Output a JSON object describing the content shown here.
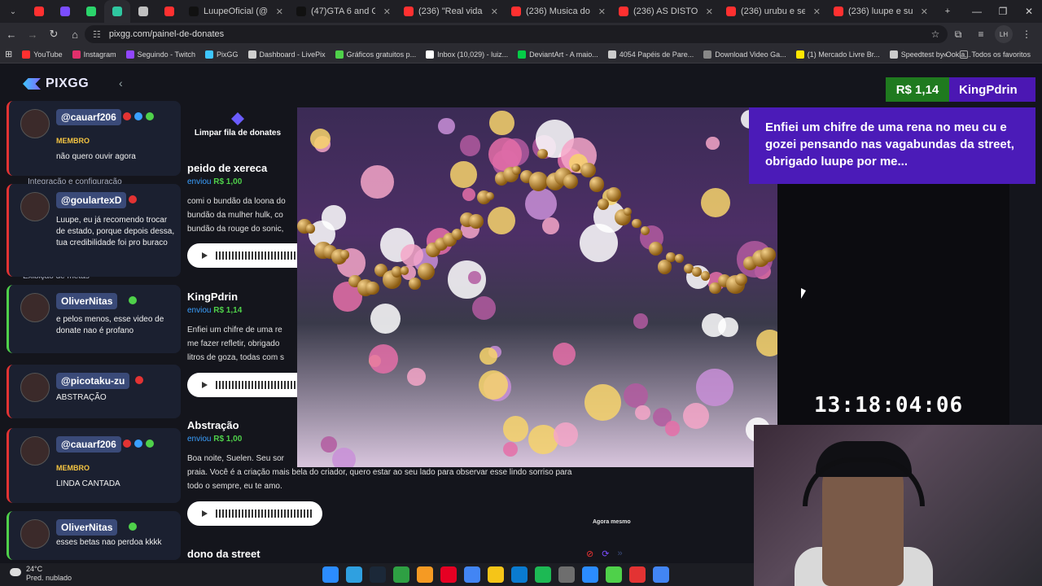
{
  "browser": {
    "tabs": [
      {
        "label": "",
        "color": "#ff3030",
        "mini": true
      },
      {
        "label": "",
        "color": "#7b4dff",
        "mini": true
      },
      {
        "label": "",
        "color": "#2bd46b",
        "mini": true
      },
      {
        "label": "",
        "color": "#2fc7a0",
        "mini": true,
        "active": true
      },
      {
        "label": "",
        "color": "#c0c0c0",
        "mini": true
      },
      {
        "label": "",
        "color": "#ff3030",
        "mini": true
      },
      {
        "label": "LuupeOficial (@luupe0f",
        "color": "#111111"
      },
      {
        "label": "(47)GTA 6 and God of W",
        "color": "#111111"
      },
      {
        "label": "(236) \"Real vida do Spid",
        "color": "#ff3030"
      },
      {
        "label": "(236) Musica do Rei da",
        "color": "#ff3030"
      },
      {
        "label": "(236) AS DISTORÇÕES",
        "color": "#ff3030"
      },
      {
        "label": "(236) urubu e seu segre",
        "color": "#ff3030"
      },
      {
        "label": "(236) luupe e sua festa",
        "color": "#ff3030"
      }
    ],
    "url": "pixgg.com/painel-de-donates",
    "bookmarks": [
      {
        "label": "YouTube",
        "color": "#ff3030"
      },
      {
        "label": "Instagram",
        "color": "#e1306c"
      },
      {
        "label": "Seguindo - Twitch",
        "color": "#9146ff"
      },
      {
        "label": "PixGG",
        "color": "#3ec6ff"
      },
      {
        "label": "Dashboard - LivePix",
        "color": "#cfcfcf"
      },
      {
        "label": "Gráficos gratuitos p...",
        "color": "#4fd14a"
      },
      {
        "label": "Inbox (10,029) - luiz...",
        "color": "#ffffff"
      },
      {
        "label": "DeviantArt - A maio...",
        "color": "#05cc47"
      },
      {
        "label": "4054 Papéis de Pare...",
        "color": "#cccccc"
      },
      {
        "label": "Download Video Ga...",
        "color": "#888888"
      },
      {
        "label": "(1) Mercado Livre Br...",
        "color": "#ffe600"
      },
      {
        "label": "Speedtest by Ookla...",
        "color": "#cccccc"
      }
    ],
    "bookmarks_all": "Todos os favoritos"
  },
  "app": {
    "logo": "PIXGG",
    "queue_clear_label": "Limpar fila de donates",
    "sidebar_labels": [
      "Integração e configuração",
      "Exibição de metas"
    ],
    "chat": [
      {
        "name": "@cauarf206",
        "membro": "MEMBRO",
        "text": "não quero ouvir agora",
        "border": "#e33333"
      },
      {
        "name": "@goulartexD",
        "membro": "",
        "text": "Luupe, eu já recomendo trocar de estado, porque depois dessa, tua credibilidade foi pro buraco",
        "border": "#e33333"
      },
      {
        "name": "OliverNitas",
        "membro": "",
        "text": "e pelos menos, esse video de donate nao é profano",
        "border": "#4fd14a"
      },
      {
        "name": "@picotaku-zu",
        "membro": "",
        "text": "ABSTRAÇÃO",
        "border": "#e33333"
      },
      {
        "name": "@cauarf206",
        "membro": "MEMBRO",
        "text": "LINDA CANTADA",
        "border": "#e33333"
      },
      {
        "name": "OliverNitas",
        "membro": "",
        "text": "esses betas nao perdoa kkkk",
        "border": "#4fd14a"
      }
    ],
    "donations": [
      {
        "name": "peido de xereca",
        "sent": "enviou",
        "amount": "R$ 1,00",
        "message": "comi o bundão da loona do",
        "message2": "bundão da mulher hulk, co",
        "message3": "bundão da rouge do sonic,"
      },
      {
        "name": "KingPdrin",
        "sent": "enviou",
        "amount": "R$ 1,14",
        "message": "Enfiei um chifre de uma re",
        "message2": "me fazer refletir, obrigado",
        "message3": "litros de goza, todas com s"
      },
      {
        "name": "Abstração",
        "sent": "enviou",
        "amount": "R$ 1,00",
        "message": "Boa noite, Suelen. Seu sor",
        "message2": "praia. Você é a criação mais bela do criador, quero estar ao seu lado para observar esse lindo sorriso para",
        "message3": "todo o sempre, eu te amo."
      },
      {
        "name": "dono da street",
        "sent": "",
        "amount": "",
        "message": "",
        "message2": "",
        "message3": ""
      }
    ],
    "agora": "Agora mesmo"
  },
  "alert": {
    "price": "R$ 1,14",
    "name": "KingPdrin",
    "message": "Enfiei um chifre de uma rena no meu cu e gozei pensando nas vagabundas da street, obrigado luupe por me..."
  },
  "timer": "13:18:04:06",
  "taskbar": {
    "weather_temp": "24°C",
    "weather_desc": "Pred. nublado",
    "icons": [
      "#2b8cff",
      "#2fa0e0",
      "#1b2838",
      "#2ea043",
      "#f59a23",
      "#e60023",
      "#4285f4",
      "#f5c518",
      "#0a7bd0",
      "#1db954",
      "#6e6e6e",
      "#2b8cff",
      "#4fd14a",
      "#e33333",
      "#4285f4"
    ]
  }
}
